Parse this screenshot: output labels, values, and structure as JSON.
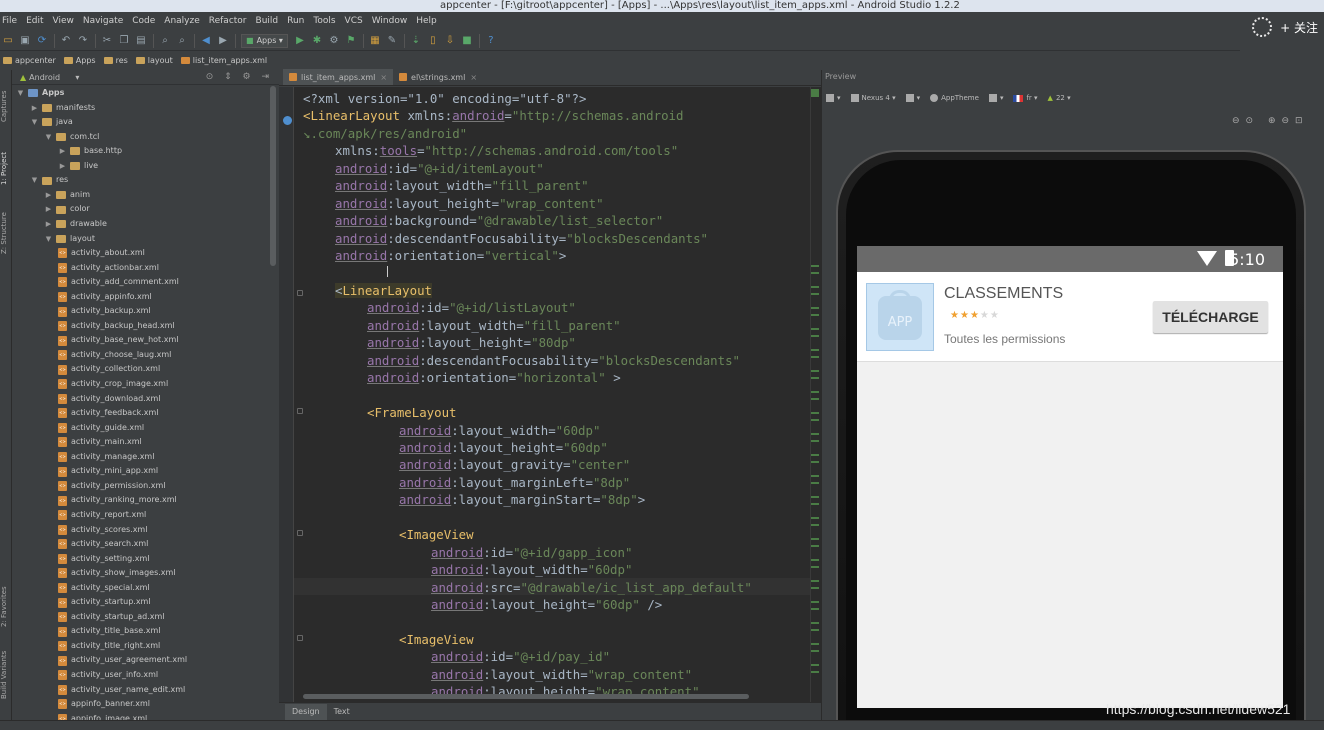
{
  "window": {
    "title": "appcenter - [F:\\gitroot\\appcenter] - [Apps] - ...\\Apps\\res\\layout\\list_item_apps.xml - Android Studio 1.2.2"
  },
  "menu": [
    "File",
    "Edit",
    "View",
    "Navigate",
    "Code",
    "Analyze",
    "Refactor",
    "Build",
    "Run",
    "Tools",
    "VCS",
    "Window",
    "Help"
  ],
  "follow": {
    "label": "+ 关注"
  },
  "toolbar": {
    "run_config": "Apps"
  },
  "breadcrumbs": [
    "appcenter",
    "Apps",
    "res",
    "layout",
    "list_item_apps.xml"
  ],
  "left_strip": {
    "captures": "Captures",
    "project": "1: Project",
    "structure": "Z: Structure",
    "favorites": "2: Favorites",
    "build_variants": "Build Variants"
  },
  "project": {
    "view_mode": "Android",
    "tree": [
      {
        "label": "Apps",
        "level": 0,
        "type": "module",
        "open": true
      },
      {
        "label": "manifests",
        "level": 1,
        "type": "folder",
        "open": false
      },
      {
        "label": "java",
        "level": 1,
        "type": "folder",
        "open": true
      },
      {
        "label": "com.tcl",
        "level": 2,
        "type": "package",
        "open": true
      },
      {
        "label": "base.http",
        "level": 3,
        "type": "package",
        "open": false
      },
      {
        "label": "live",
        "level": 3,
        "type": "package",
        "open": false
      },
      {
        "label": "res",
        "level": 1,
        "type": "folder",
        "open": true
      },
      {
        "label": "anim",
        "level": 2,
        "type": "folder",
        "open": false
      },
      {
        "label": "color",
        "level": 2,
        "type": "folder",
        "open": false
      },
      {
        "label": "drawable",
        "level": 2,
        "type": "folder",
        "open": false
      },
      {
        "label": "layout",
        "level": 2,
        "type": "folder",
        "open": true
      },
      {
        "label": "activity_about.xml",
        "level": 3,
        "type": "xml"
      },
      {
        "label": "activity_actionbar.xml",
        "level": 3,
        "type": "xml"
      },
      {
        "label": "activity_add_comment.xml",
        "level": 3,
        "type": "xml"
      },
      {
        "label": "activity_appinfo.xml",
        "level": 3,
        "type": "xml"
      },
      {
        "label": "activity_backup.xml",
        "level": 3,
        "type": "xml"
      },
      {
        "label": "activity_backup_head.xml",
        "level": 3,
        "type": "xml"
      },
      {
        "label": "activity_base_new_hot.xml",
        "level": 3,
        "type": "xml"
      },
      {
        "label": "activity_choose_laug.xml",
        "level": 3,
        "type": "xml"
      },
      {
        "label": "activity_collection.xml",
        "level": 3,
        "type": "xml"
      },
      {
        "label": "activity_crop_image.xml",
        "level": 3,
        "type": "xml"
      },
      {
        "label": "activity_download.xml",
        "level": 3,
        "type": "xml"
      },
      {
        "label": "activity_feedback.xml",
        "level": 3,
        "type": "xml"
      },
      {
        "label": "activity_guide.xml",
        "level": 3,
        "type": "xml"
      },
      {
        "label": "activity_main.xml",
        "level": 3,
        "type": "xml"
      },
      {
        "label": "activity_manage.xml",
        "level": 3,
        "type": "xml"
      },
      {
        "label": "activity_mini_app.xml",
        "level": 3,
        "type": "xml"
      },
      {
        "label": "activity_permission.xml",
        "level": 3,
        "type": "xml"
      },
      {
        "label": "activity_ranking_more.xml",
        "level": 3,
        "type": "xml"
      },
      {
        "label": "activity_report.xml",
        "level": 3,
        "type": "xml"
      },
      {
        "label": "activity_scores.xml",
        "level": 3,
        "type": "xml"
      },
      {
        "label": "activity_search.xml",
        "level": 3,
        "type": "xml"
      },
      {
        "label": "activity_setting.xml",
        "level": 3,
        "type": "xml"
      },
      {
        "label": "activity_show_images.xml",
        "level": 3,
        "type": "xml"
      },
      {
        "label": "activity_special.xml",
        "level": 3,
        "type": "xml"
      },
      {
        "label": "activity_startup.xml",
        "level": 3,
        "type": "xml"
      },
      {
        "label": "activity_startup_ad.xml",
        "level": 3,
        "type": "xml"
      },
      {
        "label": "activity_title_base.xml",
        "level": 3,
        "type": "xml"
      },
      {
        "label": "activity_title_right.xml",
        "level": 3,
        "type": "xml"
      },
      {
        "label": "activity_user_agreement.xml",
        "level": 3,
        "type": "xml"
      },
      {
        "label": "activity_user_info.xml",
        "level": 3,
        "type": "xml"
      },
      {
        "label": "activity_user_name_edit.xml",
        "level": 3,
        "type": "xml"
      },
      {
        "label": "appinfo_banner.xml",
        "level": 3,
        "type": "xml"
      },
      {
        "label": "appinfo_image.xml",
        "level": 3,
        "type": "xml"
      }
    ]
  },
  "editor_tabs": [
    {
      "label": "list_item_apps.xml",
      "active": true
    },
    {
      "label": "el\\strings.xml",
      "active": false
    }
  ],
  "code_lines": [
    {
      "indent": 0,
      "parts": [
        [
          "t",
          "<?xml version=\"1.0\" encoding=\"utf-8\"?>"
        ]
      ]
    },
    {
      "indent": 0,
      "parts": [
        [
          "k",
          "<LinearLayout"
        ],
        [
          "t",
          " xmlns:"
        ],
        [
          "n",
          "android"
        ],
        [
          "t",
          "="
        ],
        [
          "v",
          "\"http://schemas.android"
        ]
      ]
    },
    {
      "indent": 0,
      "parts": [
        [
          "v",
          "↘.com/apk/res/android\""
        ]
      ]
    },
    {
      "indent": 2,
      "parts": [
        [
          "t",
          "xmlns:"
        ],
        [
          "n",
          "tools"
        ],
        [
          "t",
          "="
        ],
        [
          "v",
          "\"http://schemas.android.com/tools\""
        ]
      ]
    },
    {
      "indent": 2,
      "parts": [
        [
          "n",
          "android"
        ],
        [
          "t",
          ":id="
        ],
        [
          "v",
          "\"@+id/itemLayout\""
        ]
      ]
    },
    {
      "indent": 2,
      "parts": [
        [
          "n",
          "android"
        ],
        [
          "t",
          ":layout_width="
        ],
        [
          "v",
          "\"fill_parent\""
        ]
      ]
    },
    {
      "indent": 2,
      "parts": [
        [
          "n",
          "android"
        ],
        [
          "t",
          ":layout_height="
        ],
        [
          "v",
          "\"wrap_content\""
        ]
      ]
    },
    {
      "indent": 2,
      "parts": [
        [
          "n",
          "android"
        ],
        [
          "t",
          ":background="
        ],
        [
          "v",
          "\"@drawable/list_selector\""
        ]
      ]
    },
    {
      "indent": 2,
      "parts": [
        [
          "n",
          "android"
        ],
        [
          "t",
          ":descendantFocusability="
        ],
        [
          "v",
          "\"blocksDescendants\""
        ]
      ]
    },
    {
      "indent": 2,
      "parts": [
        [
          "n",
          "android"
        ],
        [
          "t",
          ":orientation="
        ],
        [
          "v",
          "\"vertical\""
        ],
        [
          "t",
          ">"
        ]
      ]
    },
    {
      "indent": 0,
      "parts": []
    },
    {
      "indent": 2,
      "parts": [
        [
          "h",
          "<"
        ],
        [
          "hk",
          "LinearLayout"
        ]
      ]
    },
    {
      "indent": 4,
      "parts": [
        [
          "n",
          "android"
        ],
        [
          "t",
          ":id="
        ],
        [
          "v",
          "\"@+id/listLayout\""
        ]
      ]
    },
    {
      "indent": 4,
      "parts": [
        [
          "n",
          "android"
        ],
        [
          "t",
          ":layout_width="
        ],
        [
          "v",
          "\"fill_parent\""
        ]
      ]
    },
    {
      "indent": 4,
      "parts": [
        [
          "n",
          "android"
        ],
        [
          "t",
          ":layout_height="
        ],
        [
          "v",
          "\"80dp\""
        ]
      ]
    },
    {
      "indent": 4,
      "parts": [
        [
          "n",
          "android"
        ],
        [
          "t",
          ":descendantFocusability="
        ],
        [
          "v",
          "\"blocksDescendants\""
        ]
      ]
    },
    {
      "indent": 4,
      "parts": [
        [
          "n",
          "android"
        ],
        [
          "t",
          ":orientation="
        ],
        [
          "v",
          "\"horizontal\""
        ],
        [
          "t",
          " >"
        ]
      ]
    },
    {
      "indent": 0,
      "parts": []
    },
    {
      "indent": 4,
      "parts": [
        [
          "k",
          "<FrameLayout"
        ]
      ]
    },
    {
      "indent": 6,
      "parts": [
        [
          "n",
          "android"
        ],
        [
          "t",
          ":layout_width="
        ],
        [
          "v",
          "\"60dp\""
        ]
      ]
    },
    {
      "indent": 6,
      "parts": [
        [
          "n",
          "android"
        ],
        [
          "t",
          ":layout_height="
        ],
        [
          "v",
          "\"60dp\""
        ]
      ]
    },
    {
      "indent": 6,
      "parts": [
        [
          "n",
          "android"
        ],
        [
          "t",
          ":layout_gravity="
        ],
        [
          "v",
          "\"center\""
        ]
      ]
    },
    {
      "indent": 6,
      "parts": [
        [
          "n",
          "android"
        ],
        [
          "t",
          ":layout_marginLeft="
        ],
        [
          "v",
          "\"8dp\""
        ]
      ]
    },
    {
      "indent": 6,
      "parts": [
        [
          "n",
          "android"
        ],
        [
          "t",
          ":layout_marginStart="
        ],
        [
          "v",
          "\"8dp\""
        ],
        [
          "t",
          ">"
        ]
      ]
    },
    {
      "indent": 0,
      "parts": []
    },
    {
      "indent": 6,
      "parts": [
        [
          "k",
          "<ImageView"
        ]
      ]
    },
    {
      "indent": 8,
      "parts": [
        [
          "n",
          "android"
        ],
        [
          "t",
          ":id="
        ],
        [
          "v",
          "\"@+id/gapp_icon\""
        ]
      ]
    },
    {
      "indent": 8,
      "parts": [
        [
          "n",
          "android"
        ],
        [
          "t",
          ":layout_width="
        ],
        [
          "v",
          "\"60dp\""
        ]
      ]
    },
    {
      "indent": 8,
      "parts": [
        [
          "n",
          "android"
        ],
        [
          "t",
          ":src="
        ],
        [
          "v",
          "\"@drawable/ic_list_app_default\""
        ]
      ]
    },
    {
      "indent": 8,
      "parts": [
        [
          "n",
          "android"
        ],
        [
          "t",
          ":layout_height="
        ],
        [
          "v",
          "\"60dp\""
        ],
        [
          "t",
          " />"
        ]
      ]
    },
    {
      "indent": 0,
      "parts": []
    },
    {
      "indent": 6,
      "parts": [
        [
          "k",
          "<ImageView"
        ]
      ]
    },
    {
      "indent": 8,
      "parts": [
        [
          "n",
          "android"
        ],
        [
          "t",
          ":id="
        ],
        [
          "v",
          "\"@+id/pay_id\""
        ]
      ]
    },
    {
      "indent": 8,
      "parts": [
        [
          "n",
          "android"
        ],
        [
          "t",
          ":layout_width="
        ],
        [
          "v",
          "\"wrap_content\""
        ]
      ]
    },
    {
      "indent": 8,
      "parts": [
        [
          "n",
          "android"
        ],
        [
          "t",
          ":layout_height="
        ],
        [
          "v",
          "\"wrap_content\""
        ]
      ]
    }
  ],
  "bottom_tabs": [
    "Design",
    "Text"
  ],
  "preview": {
    "title": "Preview",
    "device": "Nexus 4",
    "theme": "AppTheme",
    "locale": "fr",
    "api": "22",
    "status_time": "5:10",
    "app_icon_label": "APP",
    "app_title": "CLASSEMENTS",
    "rating": 3,
    "rating_max": 5,
    "permissions": "Toutes les permissions",
    "download": "TÉLÉCHARGE"
  },
  "watermark": "https://blog.csdn.net/lidew521",
  "colors": {
    "accent_star": "#f0a030",
    "xml_tag": "#e8bf6a",
    "xml_ns": "#9876aa",
    "xml_value": "#6a8759"
  }
}
